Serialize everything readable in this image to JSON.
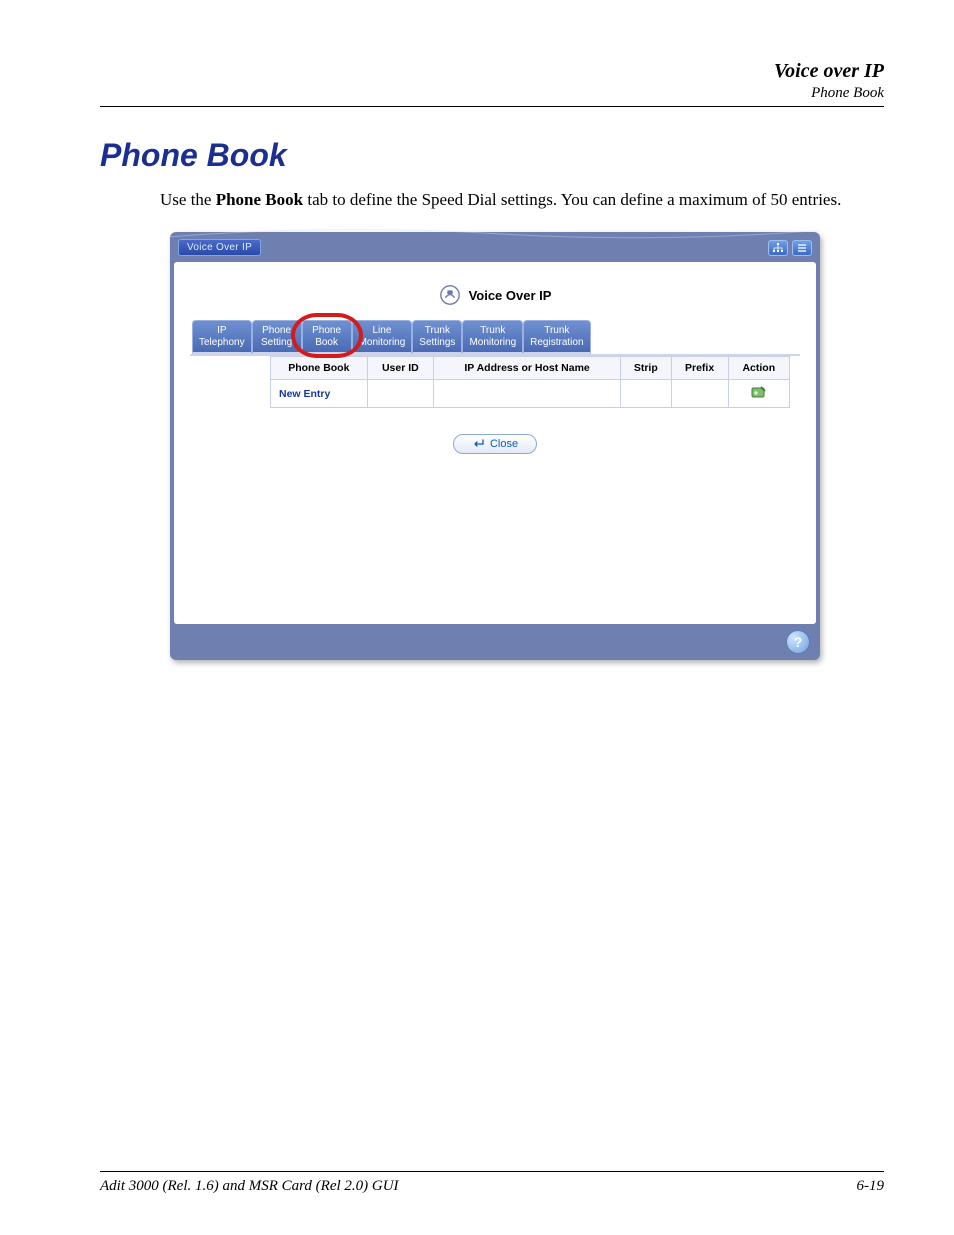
{
  "header": {
    "section": "Voice over IP",
    "subsection": "Phone Book"
  },
  "title": "Phone Book",
  "intro": {
    "prefix": "Use the ",
    "bold": "Phone Book",
    "suffix": " tab to define the Speed Dial settings. You can define a maximum of 50 entries."
  },
  "window": {
    "titlebar": "Voice Over IP",
    "heading": "Voice Over IP",
    "icons": {
      "tree": "tree-icon",
      "grid": "grid-icon",
      "help": "?"
    },
    "tabs": [
      {
        "line1": "IP",
        "line2": "Telephony"
      },
      {
        "line1": "Phone",
        "line2": "Setting"
      },
      {
        "line1": "Phone",
        "line2": "Book",
        "active": true
      },
      {
        "line1": "Line",
        "line2": "Monitoring"
      },
      {
        "line1": "Trunk",
        "line2": "Settings"
      },
      {
        "line1": "Trunk",
        "line2": "Monitoring"
      },
      {
        "line1": "Trunk",
        "line2": "Registration"
      }
    ],
    "table": {
      "headers": [
        "Phone Book",
        "User ID",
        "IP Address or Host Name",
        "Strip",
        "Prefix",
        "Action"
      ],
      "row": {
        "label": "New Entry"
      }
    },
    "close": "Close"
  },
  "footer": {
    "left": "Adit 3000 (Rel. 1.6) and MSR Card (Rel 2.0) GUI",
    "right": "6-19"
  }
}
